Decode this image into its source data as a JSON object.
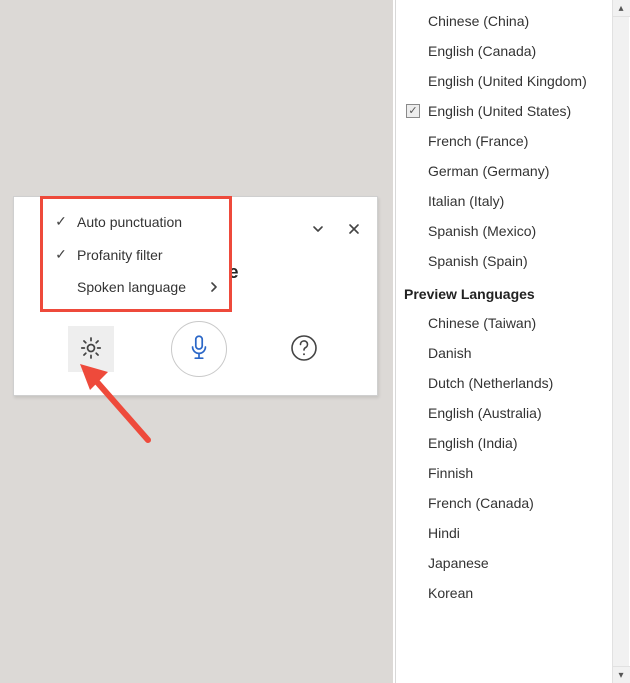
{
  "card": {
    "status_text": "to resume"
  },
  "settings_menu": {
    "items": [
      {
        "label": "Auto punctuation",
        "checked": true,
        "has_submenu": false
      },
      {
        "label": "Profanity filter",
        "checked": true,
        "has_submenu": false
      },
      {
        "label": "Spoken language",
        "checked": false,
        "has_submenu": true
      }
    ]
  },
  "language_panel": {
    "main": [
      {
        "label": "Chinese (China)",
        "selected": false
      },
      {
        "label": "English (Canada)",
        "selected": false
      },
      {
        "label": "English (United Kingdom)",
        "selected": false
      },
      {
        "label": "English (United States)",
        "selected": true
      },
      {
        "label": "French (France)",
        "selected": false
      },
      {
        "label": "German (Germany)",
        "selected": false
      },
      {
        "label": "Italian (Italy)",
        "selected": false
      },
      {
        "label": "Spanish (Mexico)",
        "selected": false
      },
      {
        "label": "Spanish (Spain)",
        "selected": false
      }
    ],
    "preview_header": "Preview Languages",
    "preview": [
      {
        "label": "Chinese (Taiwan)"
      },
      {
        "label": "Danish"
      },
      {
        "label": "Dutch (Netherlands)"
      },
      {
        "label": "English (Australia)"
      },
      {
        "label": "English (India)"
      },
      {
        "label": "Finnish"
      },
      {
        "label": "French (Canada)"
      },
      {
        "label": "Hindi"
      },
      {
        "label": "Japanese"
      },
      {
        "label": "Korean"
      }
    ]
  },
  "colors": {
    "highlight_red": "#ee4a3b",
    "mic_blue": "#2b67c7"
  }
}
